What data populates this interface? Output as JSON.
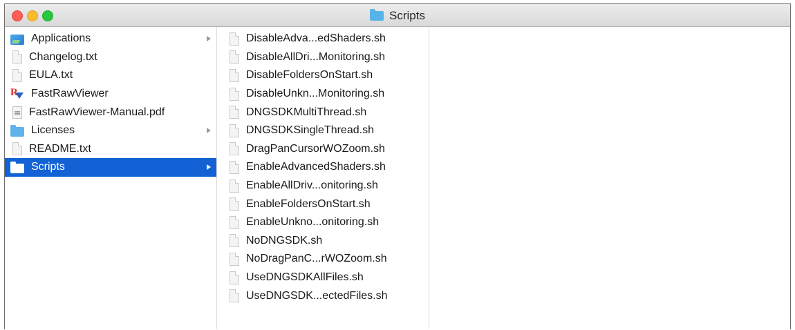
{
  "window": {
    "title": "Scripts",
    "title_icon": "folder-icon"
  },
  "column1": {
    "items": [
      {
        "label": "Applications",
        "icon": "applications-folder-icon",
        "has_children": true,
        "selected": false
      },
      {
        "label": "Changelog.txt",
        "icon": "text-document-icon",
        "has_children": false,
        "selected": false
      },
      {
        "label": "EULA.txt",
        "icon": "text-document-icon",
        "has_children": false,
        "selected": false
      },
      {
        "label": "FastRawViewer",
        "icon": "fastrawviewer-app-icon",
        "has_children": false,
        "selected": false
      },
      {
        "label": "FastRawViewer-Manual.pdf",
        "icon": "pdf-document-icon",
        "has_children": false,
        "selected": false
      },
      {
        "label": "Licenses",
        "icon": "folder-icon",
        "has_children": true,
        "selected": false
      },
      {
        "label": "README.txt",
        "icon": "text-document-icon",
        "has_children": false,
        "selected": false
      },
      {
        "label": "Scripts",
        "icon": "folder-icon",
        "has_children": true,
        "selected": true
      }
    ]
  },
  "column2": {
    "items": [
      {
        "label": "DisableAdva...edShaders.sh",
        "icon": "script-document-icon"
      },
      {
        "label": "DisableAllDri...Monitoring.sh",
        "icon": "script-document-icon"
      },
      {
        "label": "DisableFoldersOnStart.sh",
        "icon": "script-document-icon"
      },
      {
        "label": "DisableUnkn...Monitoring.sh",
        "icon": "script-document-icon"
      },
      {
        "label": "DNGSDKMultiThread.sh",
        "icon": "script-document-icon"
      },
      {
        "label": "DNGSDKSingleThread.sh",
        "icon": "script-document-icon"
      },
      {
        "label": "DragPanCursorWOZoom.sh",
        "icon": "script-document-icon"
      },
      {
        "label": "EnableAdvancedShaders.sh",
        "icon": "script-document-icon"
      },
      {
        "label": "EnableAllDriv...onitoring.sh",
        "icon": "script-document-icon"
      },
      {
        "label": "EnableFoldersOnStart.sh",
        "icon": "script-document-icon"
      },
      {
        "label": "EnableUnkno...onitoring.sh",
        "icon": "script-document-icon"
      },
      {
        "label": "NoDNGSDK.sh",
        "icon": "script-document-icon"
      },
      {
        "label": "NoDragPanC...rWOZoom.sh",
        "icon": "script-document-icon"
      },
      {
        "label": "UseDNGSDKAllFiles.sh",
        "icon": "script-document-icon"
      },
      {
        "label": "UseDNGSDK...ectedFiles.sh",
        "icon": "script-document-icon"
      }
    ]
  },
  "colors": {
    "selection": "#1262d6",
    "folder": "#5fb3ea",
    "close": "#fd5f57",
    "minimize": "#fdbc2e",
    "maximize": "#29c73f"
  }
}
